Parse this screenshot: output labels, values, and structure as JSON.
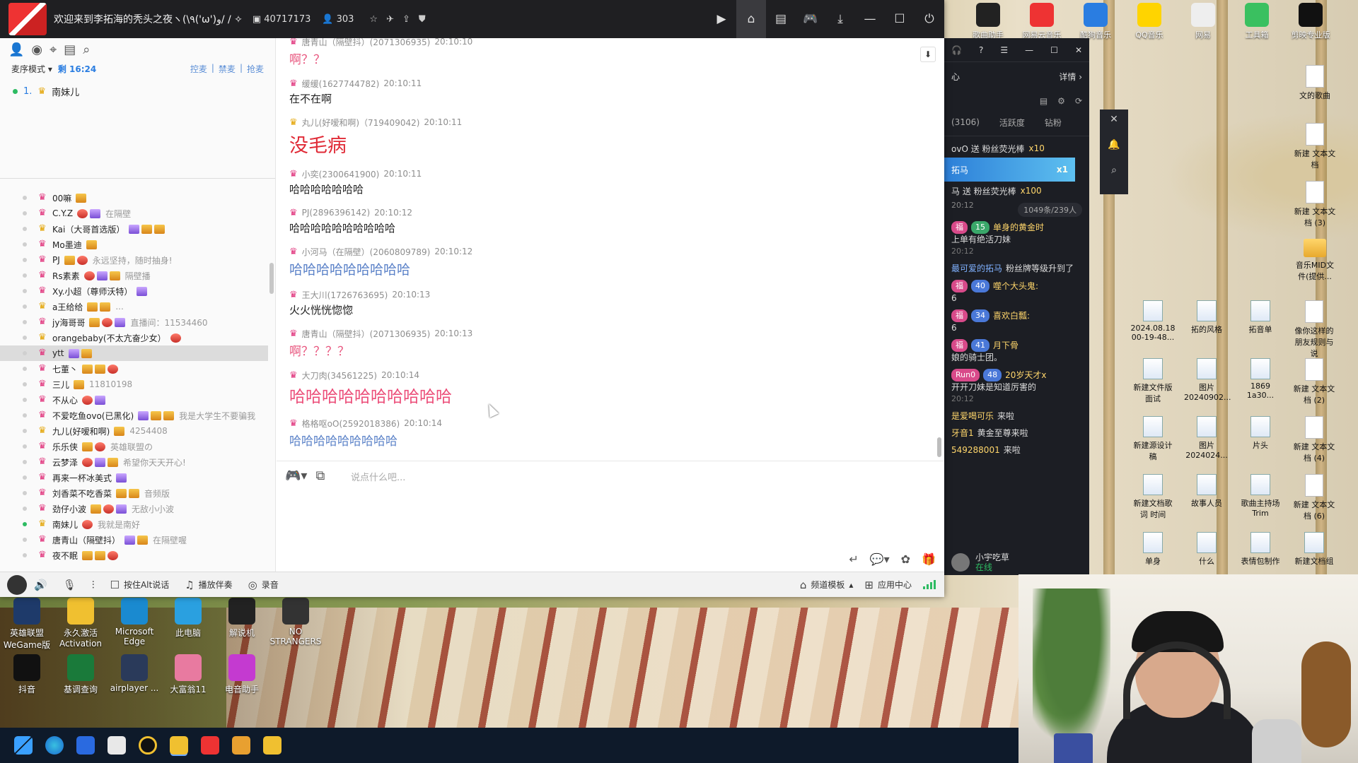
{
  "window": {
    "channel_title": "欢迎来到李拓海的秃头之夜ヽ(\\٩('ω')و/ / ✧",
    "channel_id": "40717173",
    "online_count": "303"
  },
  "left_panel": {
    "mode": "麦序模式",
    "remaining": "剩 16:24",
    "actions": [
      "控麦",
      "禁麦",
      "抢麦"
    ],
    "queue": [
      {
        "index": "1.",
        "name": "南妹儿"
      }
    ],
    "users": [
      {
        "name": "00嘛",
        "sig": ""
      },
      {
        "name": "C.Y.Z",
        "sig": "在隔壁"
      },
      {
        "name": "Kai（大哥首选版）",
        "sig": ""
      },
      {
        "name": "Mo墨迪",
        "sig": ""
      },
      {
        "name": "PJ",
        "sig": "永远坚持，随时抽身!"
      },
      {
        "name": "Rs素素",
        "sig": "隔壁播"
      },
      {
        "name": "Xy.小超（尊师沃特）",
        "sig": ""
      },
      {
        "name": "a王给给",
        "sig": "..."
      },
      {
        "name": "jy海哥哥",
        "sig": "直播间：11534460"
      },
      {
        "name": "orangebaby(不太亢奋少女）",
        "sig": ""
      },
      {
        "name": "ytt",
        "sig": ""
      },
      {
        "name": "七董丶",
        "sig": ""
      },
      {
        "name": "三儿",
        "sig": "11810198"
      },
      {
        "name": "不从心",
        "sig": ""
      },
      {
        "name": "不爱吃鱼ovo(已黑化)",
        "sig": "我是大学生不要骗我"
      },
      {
        "name": "九儿(好嗳和啊)",
        "sig": "4254408"
      },
      {
        "name": "乐乐侠",
        "sig": "英雄联盟の"
      },
      {
        "name": "云梦泽",
        "sig": "希望你天天开心!"
      },
      {
        "name": "再来一杯冰美式",
        "sig": ""
      },
      {
        "name": "刘香菜不吃香菜",
        "sig": "音频版"
      },
      {
        "name": "劲仔小波",
        "sig": "无敌小小波"
      },
      {
        "name": "南妹儿",
        "sig": "我就是南好"
      },
      {
        "name": "唐青山（隔壁抖）",
        "sig": "在隔壁喔"
      },
      {
        "name": "夜不眠",
        "sig": ""
      }
    ]
  },
  "chat": {
    "messages": [
      {
        "user": "唐青山（隔壁抖）(2071306935)",
        "time": "20:10:10",
        "text": "啊？？",
        "style": "t-pink"
      },
      {
        "user": "缓缓(1627744782)",
        "time": "20:10:11",
        "text": "在不在啊",
        "style": "t-black"
      },
      {
        "user": "丸儿(好嗳和啊)（719409042)",
        "time": "20:10:11",
        "text": "没毛病",
        "style": "t-red"
      },
      {
        "user": "小奕(2300641900)",
        "time": "20:10:11",
        "text": "哈哈哈哈哈哈哈",
        "style": "t-black"
      },
      {
        "user": "PJ(2896396142)",
        "time": "20:10:12",
        "text": "哈哈哈哈哈哈哈哈哈哈",
        "style": "t-black"
      },
      {
        "user": "小河马（在隔壁）(2060809789)",
        "time": "20:10:12",
        "text": "哈哈哈哈哈哈哈哈哈",
        "style": "t-blue"
      },
      {
        "user": "王大川(1726763695)",
        "time": "20:10:13",
        "text": "火火恍恍惚惚",
        "style": "t-black"
      },
      {
        "user": "唐青山（隔壁抖）(2071306935)",
        "time": "20:10:13",
        "text": "啊？？？？",
        "style": "t-pink"
      },
      {
        "user": "大刀肉(34561225)",
        "time": "20:10:14",
        "text": "哈哈哈哈哈哈哈哈哈哈",
        "style": "t-big-pink"
      },
      {
        "user": "格格呕oO(2592018386)",
        "time": "20:10:14",
        "text": "哈哈哈哈哈哈哈哈哈",
        "style": "t-blue-sm"
      }
    ],
    "input_placeholder": "说点什么吧..."
  },
  "bottom_bar": {
    "push_to_talk": "按住Alt说话",
    "accompaniment": "播放伴奏",
    "record": "录音",
    "template": "频道模板",
    "app_center": "应用中心"
  },
  "side_panel": {
    "detail": "详情",
    "center_suffix": "心",
    "tabs": [
      "(3106)",
      "活跃度",
      "钻粉"
    ],
    "gifts": [
      {
        "text": "ovO 送 粉丝荧光棒",
        "count": "x10"
      },
      {
        "text": "拓马",
        "count": "x1",
        "big": "x100"
      },
      {
        "text": "马 送 粉丝荧光棒",
        "count": "x100"
      }
    ],
    "time": "20:12",
    "count_pill": "1049条/239人",
    "lines": [
      {
        "badge": "福",
        "level": "15",
        "name": "单身的黄金时",
        "text": "上单有绝活刀妹",
        "time": "20:12"
      },
      {
        "name": "最可爱的拓马",
        "text": "粉丝牌等级升到了",
        "sys": true
      },
      {
        "badge": "福",
        "level": "40",
        "name": "噬个大头鬼:",
        "text": "6"
      },
      {
        "badge": "福",
        "level": "34",
        "name": "喜欢白瓢:",
        "text": "6"
      },
      {
        "badge": "福",
        "level": "41",
        "name": "月下骨",
        "text": "娘的骑士团。"
      },
      {
        "badge": "Run0",
        "level": "48",
        "name": "20岁天才x",
        "text": "开开刀妹是知道厉害的",
        "time": "20:12"
      },
      {
        "name": "是爱喝可乐",
        "text": "来啦"
      },
      {
        "name": "牙音1",
        "text": "黄金至尊来啦"
      },
      {
        "name": "549288001",
        "text": "来啦"
      }
    ],
    "user_name": "小宇吃草",
    "user_status": "在线"
  },
  "desktop_icons_top": [
    {
      "label": "歌曲助手"
    },
    {
      "label": "网易云音乐"
    },
    {
      "label": "酷狗音乐"
    },
    {
      "label": "QQ音乐"
    },
    {
      "label": "网易"
    },
    {
      "label": "工具箱"
    },
    {
      "label": "剪映专业版"
    }
  ],
  "desktop_icons_right": [
    {
      "label": "文的歌曲"
    },
    {
      "label": "新建 文本文档"
    },
    {
      "label": "新建 文本文档 (3)"
    },
    {
      "label": "音乐MID文件(提供..."
    },
    {
      "label": "2024.08.18 00-19-48..."
    },
    {
      "label": "拓的风格"
    },
    {
      "label": "拓音单"
    },
    {
      "label": "像你这样的朋友规则与说"
    },
    {
      "label": "新建文件版面试"
    },
    {
      "label": "图片 20240902..."
    },
    {
      "label": "1869 1a30..."
    },
    {
      "label": "新建 文本文档 (2)"
    },
    {
      "label": "新建源设计稿"
    },
    {
      "label": "图片 2024024..."
    },
    {
      "label": "片头"
    },
    {
      "label": "新建 文本文档 (4)"
    },
    {
      "label": "新建文档歌词 时间"
    },
    {
      "label": "故事人员"
    },
    {
      "label": "歌曲主持场 Trim"
    },
    {
      "label": "新建 文本文档 (6)"
    },
    {
      "label": "单身"
    },
    {
      "label": "什么"
    },
    {
      "label": "表情包制作"
    },
    {
      "label": "新建文档组"
    }
  ],
  "desktop_icons_left": [
    {
      "label": "英雄联盟 WeGame版"
    },
    {
      "label": "永久激活 Activation"
    },
    {
      "label": "Microsoft Edge"
    },
    {
      "label": "此电脑"
    },
    {
      "label": "解说机"
    },
    {
      "label": "NO STRANGERS"
    },
    {
      "label": "抖音"
    },
    {
      "label": "基调查询"
    },
    {
      "label": "airplayer ..."
    },
    {
      "label": "大富翁11"
    },
    {
      "label": "电音助手"
    }
  ],
  "colors": {
    "accent_blue": "#2a7de1",
    "pink_text": "#e8577f",
    "red_text": "#e02a36",
    "blue_text": "#5b82c8",
    "title_bg": "#1f1f22",
    "side_bg": "#1c1e24"
  }
}
